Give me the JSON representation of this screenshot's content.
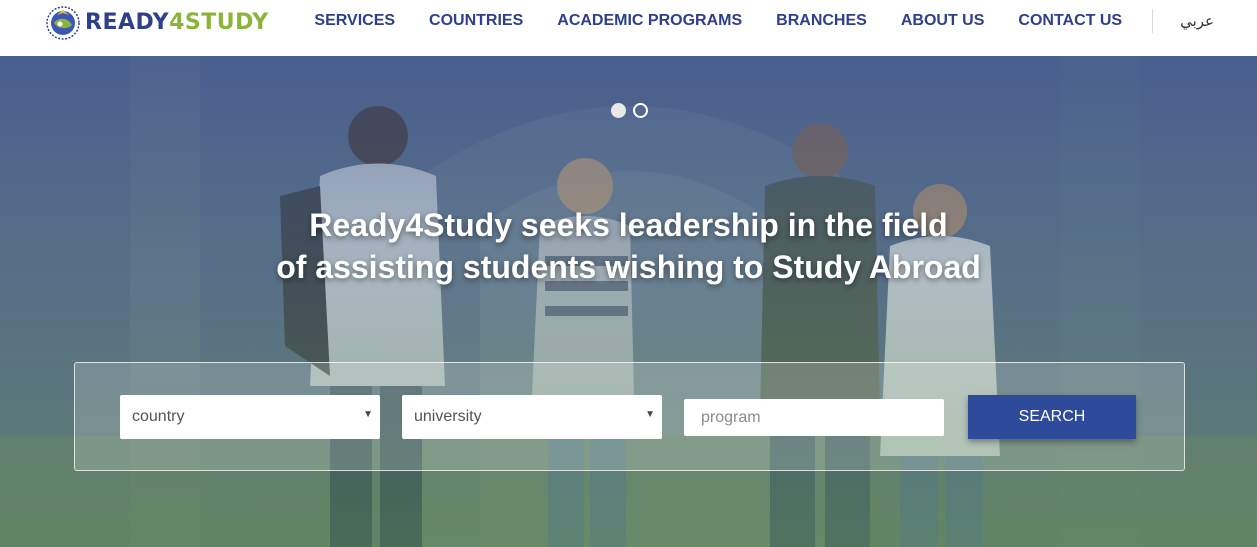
{
  "brand": {
    "name_part1": "READY",
    "name_part2": "4",
    "name_part3": "STUDY",
    "primary_color": "#2e3f8c",
    "accent_color": "#8cb43a"
  },
  "nav": {
    "items": [
      {
        "label": "SERVICES"
      },
      {
        "label": "COUNTRIES"
      },
      {
        "label": "ACADEMIC PROGRAMS"
      },
      {
        "label": "BRANCHES"
      },
      {
        "label": "ABOUT US"
      },
      {
        "label": "CONTACT US"
      }
    ],
    "language_switch": "عربي"
  },
  "hero": {
    "slide_count": 2,
    "active_slide": 1,
    "headline_line1": "Ready4Study seeks leadership in the field",
    "headline_line2": "of assisting students wishing to Study Abroad",
    "background_description_icon": "students-walking-photo"
  },
  "search": {
    "country_value": "country",
    "university_value": "university",
    "program_placeholder": "program",
    "button_label": "SEARCH",
    "button_color": "#2e4a9a"
  }
}
